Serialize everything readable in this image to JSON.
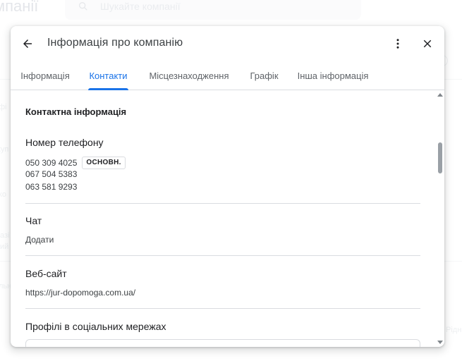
{
  "background": {
    "title": "мпанії",
    "search_placeholder": "Шукайте компанії",
    "side_texts": [
      "фі",
      "куп",
      "ко",
      "азі",
      "ий",
      "льн"
    ],
    "right_text": "Рідн"
  },
  "dialog": {
    "title": "Інформація про компанію",
    "tabs": [
      {
        "label": "Інформація"
      },
      {
        "label": "Контакти"
      },
      {
        "label": "Місцезнаходження"
      },
      {
        "label": "Графік"
      },
      {
        "label": "Інша інформація"
      }
    ],
    "active_tab": "Контакти",
    "accent_color": "#1a73e8"
  },
  "contacts": {
    "heading": "Контактна інформація",
    "phone": {
      "label": "Номер телефону",
      "numbers": [
        "050 309 4025",
        "067 504 5383",
        "063 581 9293"
      ],
      "primary_badge": "ОСНОВН."
    },
    "chat": {
      "label": "Чат",
      "value": "Додати"
    },
    "website": {
      "label": "Веб-сайт",
      "value": "https://jur-dopomoga.com.ua/"
    },
    "social": {
      "label": "Профілі в соціальних мережах"
    }
  },
  "icons": {
    "back": "arrow-back-icon",
    "more": "more-vert-icon",
    "close": "close-icon",
    "search": "search-icon"
  }
}
